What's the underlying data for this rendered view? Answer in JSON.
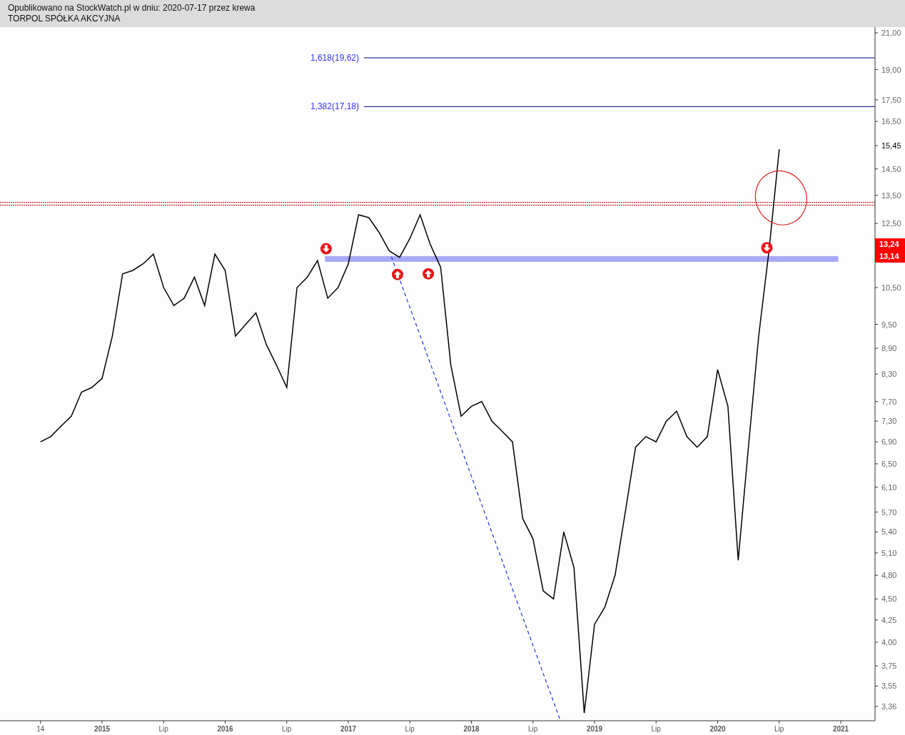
{
  "header": {
    "published": "Opublikowano na StockWatch.pl w dniu: 2020-07-17 przez krewa",
    "company": "TORPOL SPÓŁKA AKCYJNA"
  },
  "fib_levels": [
    {
      "label": "1,618(19,62)"
    },
    {
      "label": "1,382(17,18)"
    }
  ],
  "price_tags": [
    "13,24",
    "13,14"
  ],
  "y_axis_labels": [
    {
      "label": "21,00",
      "current": false
    },
    {
      "label": "19,00",
      "current": false
    },
    {
      "label": "17,50",
      "current": false
    },
    {
      "label": "16,50",
      "current": false
    },
    {
      "label": "15,45",
      "current": true
    },
    {
      "label": "14,50",
      "current": false
    },
    {
      "label": "13,50",
      "current": false
    },
    {
      "label": "12,50",
      "current": false
    },
    {
      "label": "10,50",
      "current": false
    },
    {
      "label": "9,50",
      "current": false
    },
    {
      "label": "8,90",
      "current": false
    },
    {
      "label": "8,30",
      "current": false
    },
    {
      "label": "7,70",
      "current": false
    },
    {
      "label": "7,30",
      "current": false
    },
    {
      "label": "6,90",
      "current": false
    },
    {
      "label": "6,50",
      "current": false
    },
    {
      "label": "6,10",
      "current": false
    },
    {
      "label": "5,70",
      "current": false
    },
    {
      "label": "5,40",
      "current": false
    },
    {
      "label": "5,10",
      "current": false
    },
    {
      "label": "4,80",
      "current": false
    },
    {
      "label": "4,50",
      "current": false
    },
    {
      "label": "4,25",
      "current": false
    },
    {
      "label": "4,00",
      "current": false
    },
    {
      "label": "3,75",
      "current": false
    },
    {
      "label": "3,55",
      "current": false
    },
    {
      "label": "3,36",
      "current": false
    }
  ],
  "x_axis_labels": [
    {
      "label": "14",
      "kind": "minor"
    },
    {
      "label": "2015",
      "kind": "major"
    },
    {
      "label": "Lip",
      "kind": "minor"
    },
    {
      "label": "2016",
      "kind": "major"
    },
    {
      "label": "Lip",
      "kind": "minor"
    },
    {
      "label": "2017",
      "kind": "major"
    },
    {
      "label": "Lip",
      "kind": "minor"
    },
    {
      "label": "2018",
      "kind": "major"
    },
    {
      "label": "Lip",
      "kind": "minor"
    },
    {
      "label": "2019",
      "kind": "major"
    },
    {
      "label": "Lip",
      "kind": "minor"
    },
    {
      "label": "2020",
      "kind": "major"
    },
    {
      "label": "Lip",
      "kind": "minor"
    },
    {
      "label": "2021",
      "kind": "major"
    }
  ]
}
